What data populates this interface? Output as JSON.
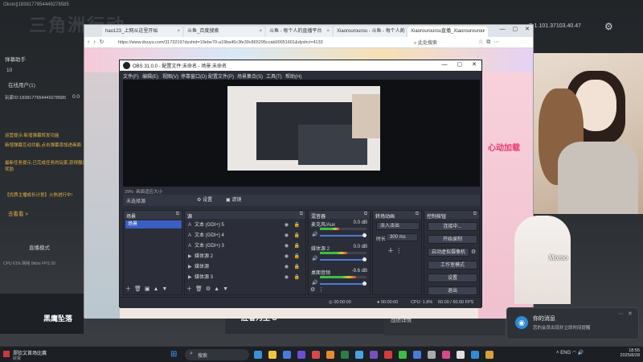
{
  "background_app": {
    "account": "Oksin||1838177654449278585",
    "logo": "三角洲行动",
    "ip_text": "P:1.101.37103.40.47",
    "left_texts": [
      {
        "text": "弹幕助手",
        "warn": false
      },
      {
        "text": "10",
        "warn": false
      },
      {
        "text": "在线用户(1)",
        "warn": false
      },
      {
        "text": "玩家ID:1838177654449278585",
        "warn": false
      },
      {
        "text": "0.0",
        "warn": false
      },
      {
        "text": "运营提示:新增弹幕转发功能",
        "warn": true
      },
      {
        "text": "新增弹幕互动功能,点击弹幕添加进画面",
        "warn": true
      },
      {
        "text": "最新任务提示,已完成任务的玩家,获得额外奖励",
        "warn": true
      },
      {
        "text": "【优质主播成长计划】火热进行中!",
        "warn": true
      },
      {
        "text": "去看看 >",
        "warn": false
      },
      {
        "text": "直播模式",
        "warn": false
      },
      {
        "text": "CPU 61%  网络 0kb/s  FPS 30",
        "warn": false
      }
    ],
    "left_tile_title": "黑鹰坠落",
    "mid_tile_title": "胜者为王 S",
    "right_tile_title": "战绩详情"
  },
  "browser": {
    "tabs": [
      {
        "label": "hao123_上网从这里开始",
        "active": false
      },
      {
        "label": "斗鱼_百度搜索",
        "active": false
      },
      {
        "label": "斗鱼 - 每个人的直播平台",
        "active": false
      },
      {
        "label": "Xiaorourourou - 斗鱼 - 每个人的",
        "active": false
      },
      {
        "label": "Xiaorourourou直播_Xiaorourourou",
        "active": true
      }
    ],
    "url": "https://www.douyu.com/31732197dyshid=19ebe70-a19ba46c3fe39c865295ccab00051601&dyshci=4133",
    "search_placeholder": "此处搜索",
    "page_badge": "心动加载"
  },
  "obs": {
    "title": "OBS 31.0.0 - 配置文件:未命名 - 场景:未命名",
    "menu": [
      "文件(F)",
      "编辑(E)",
      "视图(V)",
      "停靠窗口(D)",
      "配置文件(P)",
      "场景集合(S)",
      "工具(T)",
      "帮助(H)"
    ],
    "zoom_label": "29%",
    "zoom_hint": "画面适应大小",
    "no_source": "未选择源",
    "properties_label": "设置",
    "filters_label": "滤镜",
    "docks": {
      "scenes": "场景",
      "sources": "源",
      "mixer": "混音器",
      "transitions": "转场动画",
      "controls": "控制按钮"
    },
    "scene_item": "场景",
    "sources_list": [
      {
        "icon": "text-icon",
        "label": "文本 (GDI+) 5"
      },
      {
        "icon": "text-icon",
        "label": "文本 (GDI+) 4"
      },
      {
        "icon": "text-icon",
        "label": "文本 (GDI+) 3"
      },
      {
        "icon": "media-icon",
        "label": "媒体源 2"
      },
      {
        "icon": "media-icon",
        "label": "媒体源"
      },
      {
        "icon": "media-icon",
        "label": "媒体源 3"
      }
    ],
    "mixer_channels": [
      {
        "name": "麦克风/Aux",
        "db": "0.0 dB",
        "level": 0.42
      },
      {
        "name": "媒体源 2",
        "db": "0.0 dB",
        "level": 0.58
      },
      {
        "name": "桌面音频",
        "db": "-9.6 dB",
        "level": 0.78
      }
    ],
    "transition": {
      "type": "淡入淡出",
      "duration_label": "时长",
      "duration": "300 ms"
    },
    "controls": [
      "连接中...",
      "开始录制",
      "启动虚拟摄像机",
      "工作室模式",
      "设置",
      "退出"
    ],
    "status": {
      "rec_time": "00:00:00",
      "stream_time": "00:00:00",
      "cpu": "CPU: 1.8%",
      "fps": "60.00 / 60.00 FPS"
    }
  },
  "overlay": {
    "momo": "Momo"
  },
  "notification": {
    "title": "你的消息",
    "body": "您的会员出现并立即时间提醒"
  },
  "taskbar": {
    "news_title": "郑钦文首场比赛",
    "news_sub": "财报",
    "search_label": "搜索",
    "tray": "ENG",
    "time": "18:55",
    "date": "2025/8/28"
  },
  "colors": {
    "obs_bg": "#2b2e38",
    "obs_selected": "#3a5ec2",
    "accent_blue": "#2e8cd6",
    "meter_green": "#3bbf44"
  }
}
